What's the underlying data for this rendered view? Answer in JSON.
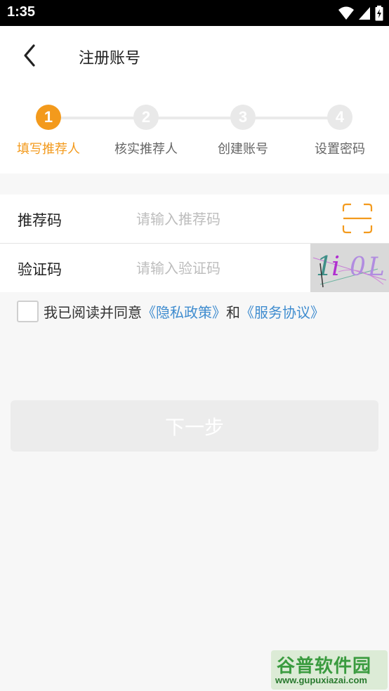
{
  "status_bar": {
    "time": "1:35"
  },
  "header": {
    "title": "注册账号"
  },
  "steps": [
    {
      "number": "1",
      "label": "填写推荐人",
      "active": true
    },
    {
      "number": "2",
      "label": "核实推荐人",
      "active": false
    },
    {
      "number": "3",
      "label": "创建账号",
      "active": false
    },
    {
      "number": "4",
      "label": "设置密码",
      "active": false
    }
  ],
  "form": {
    "referral": {
      "label": "推荐码",
      "placeholder": "请输入推荐码",
      "value": ""
    },
    "captcha": {
      "label": "验证码",
      "placeholder": "请输入验证码",
      "value": "",
      "image_text": "1i0L"
    }
  },
  "agreement": {
    "prefix": "我已阅读并同意",
    "privacy_link": "《隐私政策》",
    "conjunction": "和",
    "service_link": "《服务协议》",
    "checked": false
  },
  "next_button": {
    "label": "下一步",
    "enabled": false
  },
  "watermark": {
    "title": "谷普软件园",
    "url": "www.gupuxiazai.com"
  },
  "colors": {
    "accent": "#f39a1c",
    "link": "#3f8ccf",
    "disabled_button": "#ececec"
  }
}
